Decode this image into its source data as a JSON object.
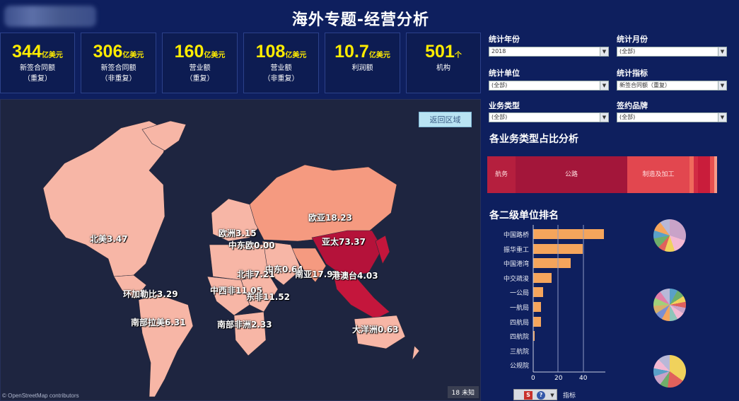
{
  "header": {
    "title": "海外专题-经营分析"
  },
  "kpis": [
    {
      "num": "344",
      "unit": "亿美元",
      "label1": "新签合同额",
      "label2": "（重复）"
    },
    {
      "num": "306",
      "unit": "亿美元",
      "label1": "新签合同额",
      "label2": "（非重复）"
    },
    {
      "num": "160",
      "unit": "亿美元",
      "label1": "营业额",
      "label2": "（重复）"
    },
    {
      "num": "108",
      "unit": "亿美元",
      "label1": "营业额",
      "label2": "（非重复）"
    },
    {
      "num": "10.7",
      "unit": "亿美元",
      "label1": "利润额",
      "label2": ""
    },
    {
      "num": "501",
      "unit": "个",
      "label1": "机构",
      "label2": ""
    }
  ],
  "map": {
    "back_button": "返回区域",
    "attribution": "© OpenStreetMap contributors",
    "unknown_badge": "18 未知",
    "regions": [
      "北美3.47",
      "欧洲3.15",
      "中东欧0.00",
      "欧亚18.23",
      "亚太73.37",
      "中东0.64",
      "北非7.21",
      "南亚17.97",
      "港澳台4.03",
      "中西非11.05",
      "东非11.52",
      "环加勒比3.29",
      "南部拉美6.31",
      "南部非洲2.33",
      "大洋洲0.63"
    ]
  },
  "filters": {
    "year": {
      "label": "统计年份",
      "value": "2018"
    },
    "month": {
      "label": "统计月份",
      "value": "(全部)"
    },
    "unit": {
      "label": "统计单位",
      "value": "(全部)"
    },
    "metric": {
      "label": "统计指标",
      "value": "新签合同额（重复）"
    },
    "biz_type": {
      "label": "业务类型",
      "value": "(全部)"
    },
    "brand": {
      "label": "签约品牌",
      "value": "(全部)"
    }
  },
  "business_share": {
    "title": "各业务类型占比分析",
    "segments": [
      {
        "label": "航务",
        "share": 0.14,
        "color": "#b51f3e"
      },
      {
        "label": "公路",
        "share": 0.56,
        "color": "#a3163a"
      },
      {
        "label": "制造及加工",
        "share": 0.31,
        "color": "#e2474f"
      },
      {
        "label": "",
        "share": 0.02,
        "color": "#f06a5c"
      },
      {
        "label": "",
        "share": 0.02,
        "color": "#d22c44"
      },
      {
        "label": "",
        "share": 0.06,
        "color": "#c91d3b"
      },
      {
        "label": "",
        "share": 0.02,
        "color": "#e8504f"
      },
      {
        "label": "",
        "share": 0.02,
        "color": "#f79a88"
      }
    ]
  },
  "ranking": {
    "title": "各二级单位排名",
    "axis_label": "指标",
    "axis_ticks": [
      0,
      20,
      40
    ],
    "items": [
      {
        "name": "中国路桥",
        "value": 57
      },
      {
        "name": "振华重工",
        "value": 40
      },
      {
        "name": "中国港湾",
        "value": 30
      },
      {
        "name": "中交疏浚",
        "value": 15
      },
      {
        "name": "一公局",
        "value": 8
      },
      {
        "name": "一航局",
        "value": 6
      },
      {
        "name": "四航局",
        "value": 6
      },
      {
        "name": "四航院",
        "value": 1
      },
      {
        "name": "三航院",
        "value": 0
      },
      {
        "name": "公规院",
        "value": 0
      }
    ]
  },
  "toolbar": {
    "s_icon": "S",
    "help_icon": "?"
  }
}
